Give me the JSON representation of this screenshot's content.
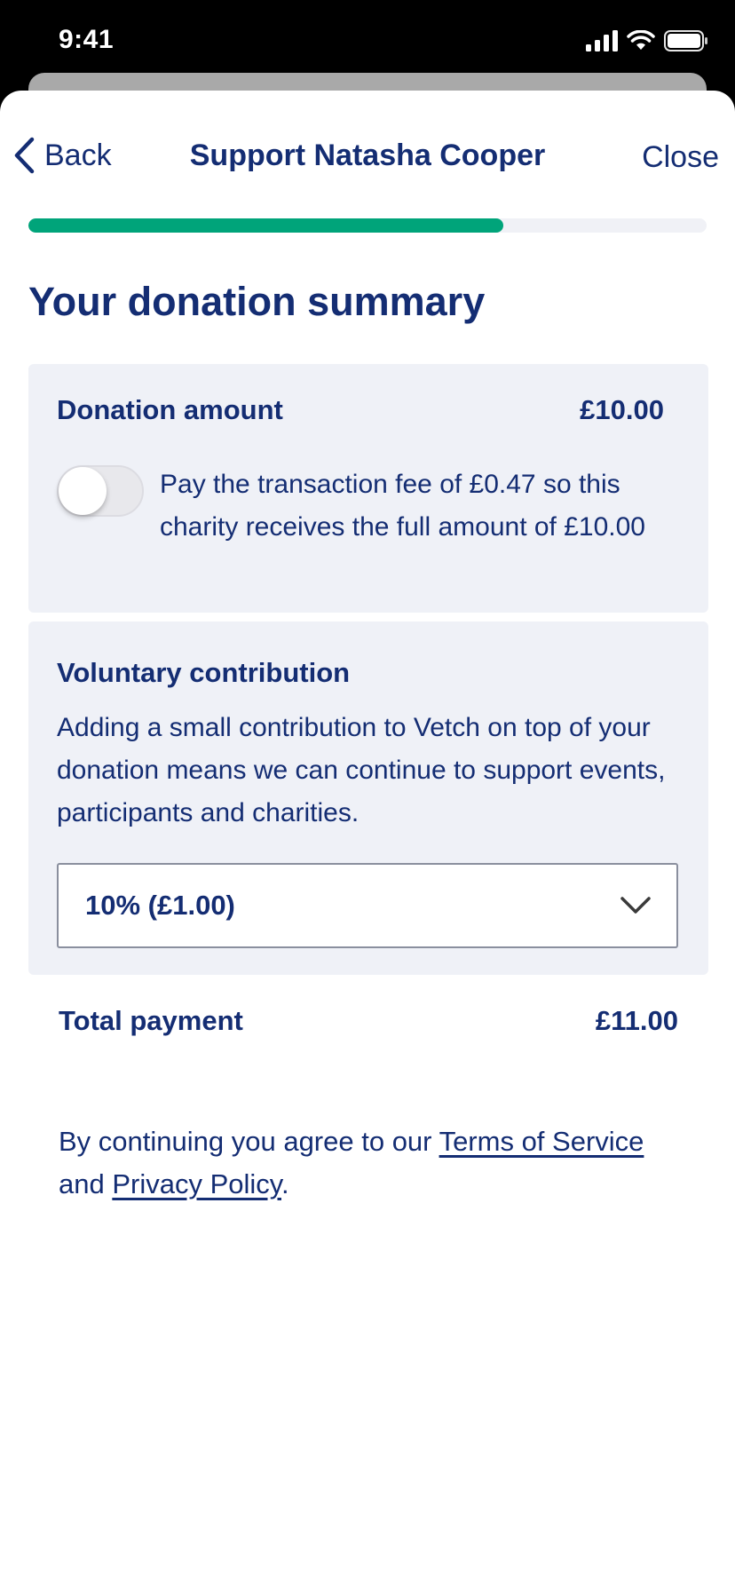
{
  "status_bar": {
    "time": "9:41"
  },
  "nav": {
    "back_label": "Back",
    "title": "Support Natasha Cooper",
    "close_label": "Close"
  },
  "progress": {
    "fraction": 0.7
  },
  "page": {
    "title": "Your donation summary"
  },
  "donation": {
    "label": "Donation amount",
    "amount": "£10.00",
    "fee_toggle_on": false,
    "fee_text": "Pay the transaction fee of £0.47 so this charity receives the full amount of £10.00"
  },
  "contribution": {
    "title": "Voluntary contribution",
    "description": "Adding a small contribution to Vetch on top of your donation means we can continue to support events, participants and charities.",
    "selected_option": "10% (£1.00)"
  },
  "total": {
    "label": "Total payment",
    "amount": "£11.00"
  },
  "legal": {
    "prefix": "By continuing you agree to our ",
    "terms_link": "Terms of Service",
    "middle": " and ",
    "privacy_link": "Privacy Policy",
    "suffix": "."
  },
  "colors": {
    "primary": "#142d73",
    "progress": "#00a47a",
    "card_bg": "#eff1f7"
  }
}
